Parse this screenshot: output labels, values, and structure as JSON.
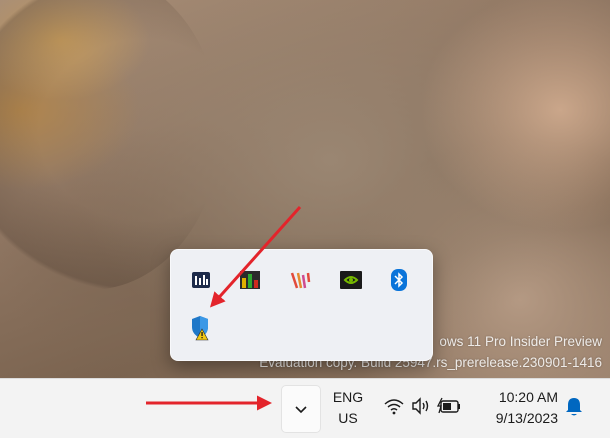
{
  "desktop": {
    "watermark_line1": "ows 11 Pro Insider Preview",
    "watermark_line2": "Evaluation copy. Build 25947.rs_prerelease.230901-1416"
  },
  "tray_flyout": {
    "icons": [
      {
        "name": "equalizer-icon"
      },
      {
        "name": "bar-chart-app-icon"
      },
      {
        "name": "stripes-app-icon"
      },
      {
        "name": "nvidia-icon"
      },
      {
        "name": "bluetooth-icon"
      },
      {
        "name": "windows-security-warning-icon"
      }
    ]
  },
  "taskbar": {
    "show_hidden_icons": "chevron-up-icon",
    "language_line1": "ENG",
    "language_line2": "US",
    "time": "10:20 AM",
    "date": "9/13/2023"
  },
  "colors": {
    "annotation_arrow": "#e3242b",
    "accent": "#0067c0"
  }
}
